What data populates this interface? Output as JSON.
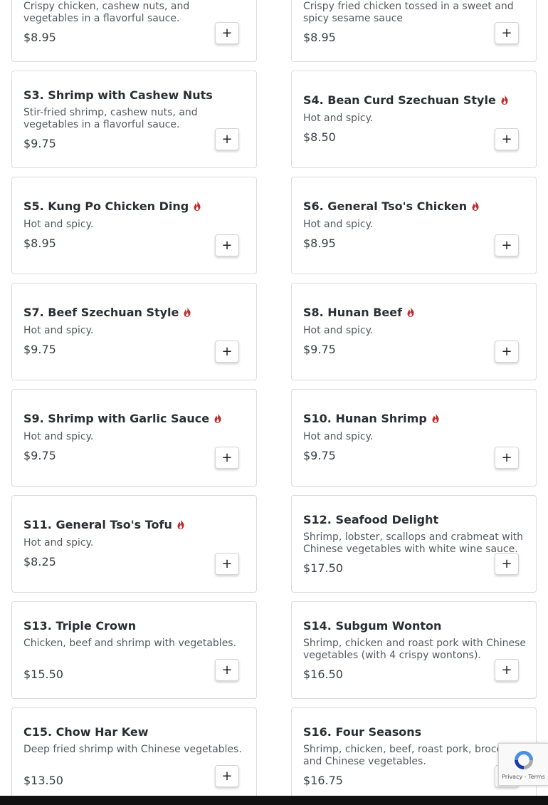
{
  "colors": {
    "flame": "#c62828",
    "card_border": "#dcdcdc"
  },
  "add_button_label": "+",
  "recaptcha": {
    "links": "Privacy - Terms"
  },
  "items": [
    {
      "name": "",
      "spicy": false,
      "desc": "Crispy chicken, cashew nuts, and vegetables in a flavorful sauce.",
      "price": "$8.95"
    },
    {
      "name": "",
      "spicy": false,
      "desc": "Crispy fried chicken tossed in a sweet and spicy sesame sauce",
      "price": "$8.95"
    },
    {
      "name": "S3. Shrimp with Cashew Nuts",
      "spicy": false,
      "desc": "Stir-fried shrimp, cashew nuts, and vegetables in a flavorful sauce.",
      "price": "$9.75"
    },
    {
      "name": "S4. Bean Curd Szechuan Style",
      "spicy": true,
      "desc": "Hot and spicy.",
      "price": "$8.50"
    },
    {
      "name": "S5. Kung Po Chicken Ding",
      "spicy": true,
      "desc": "Hot and spicy.",
      "price": "$8.95"
    },
    {
      "name": "S6. General Tso's Chicken",
      "spicy": true,
      "desc": "Hot and spicy.",
      "price": "$8.95"
    },
    {
      "name": "S7. Beef Szechuan Style",
      "spicy": true,
      "desc": "Hot and spicy.",
      "price": "$9.75"
    },
    {
      "name": "S8. Hunan Beef",
      "spicy": true,
      "desc": "Hot and spicy.",
      "price": "$9.75"
    },
    {
      "name": "S9. Shrimp with Garlic Sauce",
      "spicy": true,
      "desc": "Hot and spicy.",
      "price": "$9.75"
    },
    {
      "name": "S10. Hunan Shrimp",
      "spicy": true,
      "desc": "Hot and spicy.",
      "price": "$9.75"
    },
    {
      "name": "S11. General Tso's Tofu",
      "spicy": true,
      "desc": "Hot and spicy.",
      "price": "$8.25"
    },
    {
      "name": "S12. Seafood Delight",
      "spicy": false,
      "desc": "Shrimp, lobster, scallops and crabmeat with Chinese vegetables with white wine sauce.",
      "price": "$17.50"
    },
    {
      "name": "S13. Triple Crown",
      "spicy": false,
      "desc": "Chicken, beef and shrimp with vegetables.",
      "price": "$15.50"
    },
    {
      "name": "S14. Subgum Wonton",
      "spicy": false,
      "desc": "Shrimp, chicken and roast pork with Chinese vegetables (with 4 crispy wontons).",
      "price": "$16.50"
    },
    {
      "name": "C15. Chow Har Kew",
      "spicy": false,
      "desc": "Deep fried shrimp with Chinese vegetables.",
      "price": "$13.50"
    },
    {
      "name": "S16. Four Seasons",
      "spicy": false,
      "desc": "Shrimp, chicken, beef, roast pork, broccoli and Chinese vegetables.",
      "price": "$16.75"
    }
  ]
}
